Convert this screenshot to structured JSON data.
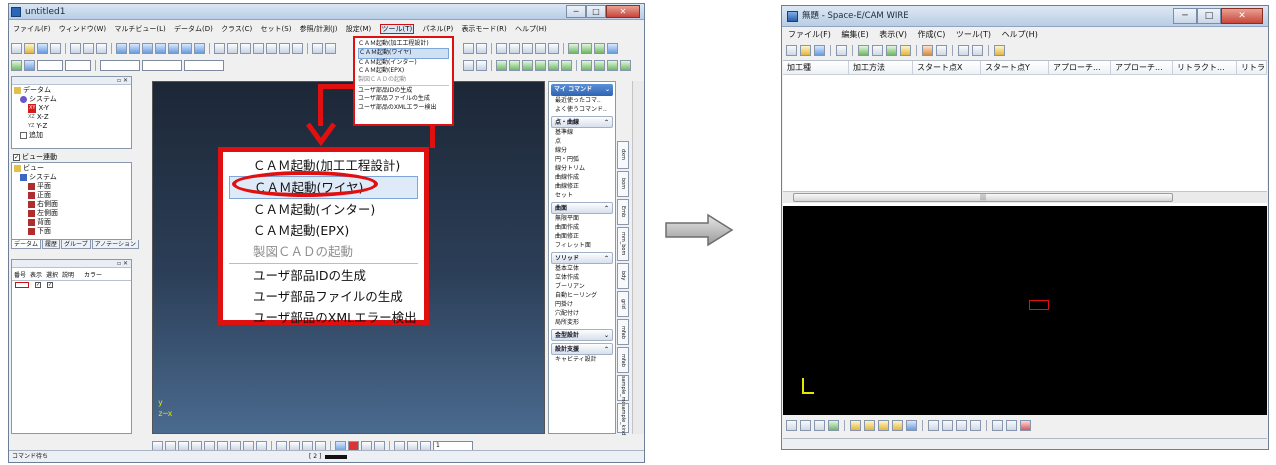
{
  "left_window": {
    "title": "untitled1",
    "caption_min": "─",
    "caption_max": "□",
    "caption_close": "✕",
    "menus": [
      "ファイル(F)",
      "ウィンドウ(W)",
      "マルチビュー(L)",
      "データム(D)",
      "クラス(C)",
      "セット(S)",
      "参照/計測(J)",
      "設定(M)",
      "ツール(T)",
      "パネル(P)",
      "表示モード(R)",
      "ヘルプ(H)"
    ],
    "tree_top": {
      "root": "データム",
      "system": "システム",
      "items": [
        "X-Y",
        "X-Z",
        "Y-Z"
      ],
      "add": "追加",
      "prefixes": [
        "XY",
        "XZ",
        "YZ"
      ]
    },
    "view_link_label": "ビュー連動",
    "tree_view": {
      "root": "ビュー",
      "system": "システム",
      "items": [
        "平面",
        "正面",
        "右側面",
        "左側面",
        "背面",
        "下面",
        "アイソメ"
      ]
    },
    "panel_tabs": [
      "データム",
      "履歴",
      "グループ",
      "アノテーション"
    ],
    "table_headers": [
      "番号",
      "表示",
      "選択",
      "説明",
      "カラー"
    ],
    "command_panel": {
      "groups": [
        {
          "title": "マイ コマンド",
          "items": [
            "最近使ったコマ..",
            "よく使うコマンド.."
          ],
          "style": "blue"
        },
        {
          "title": "点・曲線",
          "items": [
            "基準線",
            "点",
            "線分",
            "円・円弧",
            "線分トリム",
            "曲線作成",
            "曲線修正",
            "セット"
          ],
          "style": "light"
        },
        {
          "title": "曲面",
          "items": [
            "無限平面",
            "曲面作成",
            "曲面修正",
            "フィレット面"
          ],
          "style": "light"
        },
        {
          "title": "ソリッド",
          "items": [
            "基本立体",
            "立体作成",
            "ブーリアン",
            "自動ヒーリング",
            "円掛け",
            "穴配付け",
            "局所変形"
          ],
          "style": "light"
        },
        {
          "title": "金型設計",
          "items": [],
          "style": "light"
        },
        {
          "title": "設計支援",
          "items": [
            "キャビティ設計"
          ],
          "style": "light"
        }
      ]
    },
    "side_tabs": [
      "dxm",
      "bom",
      "Emb",
      "mm_bom",
      "bdy",
      "grid",
      "mfab",
      "mfab",
      "sample_mod",
      "sample_kind",
      "unit"
    ],
    "axis_y": "y",
    "axis_zx": "z─x",
    "status": {
      "text": "コマンド待ち",
      "field_value": "[ 2 ]",
      "page_counter": "1"
    }
  },
  "small_menu": {
    "items": [
      "ＣＡＭ起動(加工工程設計)",
      "ＣＡＭ起動(ワイヤ)",
      "ＣＡＭ起動(インター)",
      "ＣＡＭ起動(EPX)",
      "製図ＣＡＤの起動",
      "ユーザ部品IDの生成",
      "ユーザ部品ファイルの生成",
      "ユーザ部品のXMLエラー検出"
    ],
    "selected_index": 1,
    "disabled_index": 4
  },
  "big_menu": {
    "items": [
      "ＣＡＭ起動(加工工程設計)",
      "ＣＡＭ起動(ワイヤ)",
      "ＣＡＭ起動(インター)",
      "ＣＡＭ起動(EPX)",
      "製図ＣＡＤの起動",
      "ユーザ部品IDの生成",
      "ユーザ部品ファイルの生成",
      "ユーザ部品のXMLエラー検出"
    ],
    "selected_index": 1,
    "disabled_index": 4
  },
  "right_window": {
    "title": "無題 - Space-E/CAM WIRE",
    "caption_min": "─",
    "caption_max": "□",
    "caption_close": "✕",
    "menus": [
      "ファイル(F)",
      "編集(E)",
      "表示(V)",
      "作成(C)",
      "ツール(T)",
      "ヘルプ(H)"
    ],
    "grid_headers": [
      "加工種",
      "加工方法",
      "スタート点X",
      "スタート点Y",
      "アプローチ...",
      "アプローチ...",
      "リトラクト...",
      "リトラ"
    ],
    "scroll_thumb_glyph": "|||"
  },
  "colors": {
    "highlight_red": "#e01010",
    "viewport_left": "#2c3f58",
    "viewport_right": "#000000",
    "axis_yellow": "#e6e600",
    "command_blue": "#2f64b3"
  }
}
